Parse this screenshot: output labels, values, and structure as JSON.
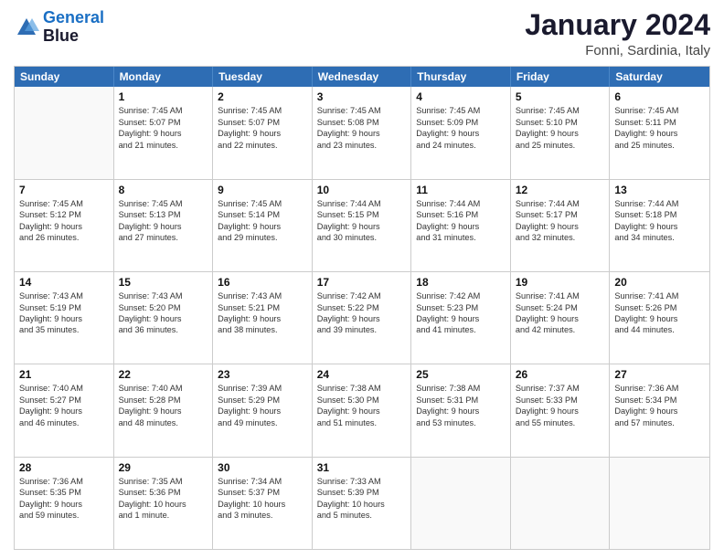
{
  "header": {
    "logo": {
      "line1": "General",
      "line2": "Blue"
    },
    "title": "January 2024",
    "location": "Fonni, Sardinia, Italy"
  },
  "days_of_week": [
    "Sunday",
    "Monday",
    "Tuesday",
    "Wednesday",
    "Thursday",
    "Friday",
    "Saturday"
  ],
  "weeks": [
    [
      {
        "day": "",
        "info": ""
      },
      {
        "day": "1",
        "info": "Sunrise: 7:45 AM\nSunset: 5:07 PM\nDaylight: 9 hours\nand 21 minutes."
      },
      {
        "day": "2",
        "info": "Sunrise: 7:45 AM\nSunset: 5:07 PM\nDaylight: 9 hours\nand 22 minutes."
      },
      {
        "day": "3",
        "info": "Sunrise: 7:45 AM\nSunset: 5:08 PM\nDaylight: 9 hours\nand 23 minutes."
      },
      {
        "day": "4",
        "info": "Sunrise: 7:45 AM\nSunset: 5:09 PM\nDaylight: 9 hours\nand 24 minutes."
      },
      {
        "day": "5",
        "info": "Sunrise: 7:45 AM\nSunset: 5:10 PM\nDaylight: 9 hours\nand 25 minutes."
      },
      {
        "day": "6",
        "info": "Sunrise: 7:45 AM\nSunset: 5:11 PM\nDaylight: 9 hours\nand 25 minutes."
      }
    ],
    [
      {
        "day": "7",
        "info": "Sunrise: 7:45 AM\nSunset: 5:12 PM\nDaylight: 9 hours\nand 26 minutes."
      },
      {
        "day": "8",
        "info": "Sunrise: 7:45 AM\nSunset: 5:13 PM\nDaylight: 9 hours\nand 27 minutes."
      },
      {
        "day": "9",
        "info": "Sunrise: 7:45 AM\nSunset: 5:14 PM\nDaylight: 9 hours\nand 29 minutes."
      },
      {
        "day": "10",
        "info": "Sunrise: 7:44 AM\nSunset: 5:15 PM\nDaylight: 9 hours\nand 30 minutes."
      },
      {
        "day": "11",
        "info": "Sunrise: 7:44 AM\nSunset: 5:16 PM\nDaylight: 9 hours\nand 31 minutes."
      },
      {
        "day": "12",
        "info": "Sunrise: 7:44 AM\nSunset: 5:17 PM\nDaylight: 9 hours\nand 32 minutes."
      },
      {
        "day": "13",
        "info": "Sunrise: 7:44 AM\nSunset: 5:18 PM\nDaylight: 9 hours\nand 34 minutes."
      }
    ],
    [
      {
        "day": "14",
        "info": "Sunrise: 7:43 AM\nSunset: 5:19 PM\nDaylight: 9 hours\nand 35 minutes."
      },
      {
        "day": "15",
        "info": "Sunrise: 7:43 AM\nSunset: 5:20 PM\nDaylight: 9 hours\nand 36 minutes."
      },
      {
        "day": "16",
        "info": "Sunrise: 7:43 AM\nSunset: 5:21 PM\nDaylight: 9 hours\nand 38 minutes."
      },
      {
        "day": "17",
        "info": "Sunrise: 7:42 AM\nSunset: 5:22 PM\nDaylight: 9 hours\nand 39 minutes."
      },
      {
        "day": "18",
        "info": "Sunrise: 7:42 AM\nSunset: 5:23 PM\nDaylight: 9 hours\nand 41 minutes."
      },
      {
        "day": "19",
        "info": "Sunrise: 7:41 AM\nSunset: 5:24 PM\nDaylight: 9 hours\nand 42 minutes."
      },
      {
        "day": "20",
        "info": "Sunrise: 7:41 AM\nSunset: 5:26 PM\nDaylight: 9 hours\nand 44 minutes."
      }
    ],
    [
      {
        "day": "21",
        "info": "Sunrise: 7:40 AM\nSunset: 5:27 PM\nDaylight: 9 hours\nand 46 minutes."
      },
      {
        "day": "22",
        "info": "Sunrise: 7:40 AM\nSunset: 5:28 PM\nDaylight: 9 hours\nand 48 minutes."
      },
      {
        "day": "23",
        "info": "Sunrise: 7:39 AM\nSunset: 5:29 PM\nDaylight: 9 hours\nand 49 minutes."
      },
      {
        "day": "24",
        "info": "Sunrise: 7:38 AM\nSunset: 5:30 PM\nDaylight: 9 hours\nand 51 minutes."
      },
      {
        "day": "25",
        "info": "Sunrise: 7:38 AM\nSunset: 5:31 PM\nDaylight: 9 hours\nand 53 minutes."
      },
      {
        "day": "26",
        "info": "Sunrise: 7:37 AM\nSunset: 5:33 PM\nDaylight: 9 hours\nand 55 minutes."
      },
      {
        "day": "27",
        "info": "Sunrise: 7:36 AM\nSunset: 5:34 PM\nDaylight: 9 hours\nand 57 minutes."
      }
    ],
    [
      {
        "day": "28",
        "info": "Sunrise: 7:36 AM\nSunset: 5:35 PM\nDaylight: 9 hours\nand 59 minutes."
      },
      {
        "day": "29",
        "info": "Sunrise: 7:35 AM\nSunset: 5:36 PM\nDaylight: 10 hours\nand 1 minute."
      },
      {
        "day": "30",
        "info": "Sunrise: 7:34 AM\nSunset: 5:37 PM\nDaylight: 10 hours\nand 3 minutes."
      },
      {
        "day": "31",
        "info": "Sunrise: 7:33 AM\nSunset: 5:39 PM\nDaylight: 10 hours\nand 5 minutes."
      },
      {
        "day": "",
        "info": ""
      },
      {
        "day": "",
        "info": ""
      },
      {
        "day": "",
        "info": ""
      }
    ]
  ]
}
